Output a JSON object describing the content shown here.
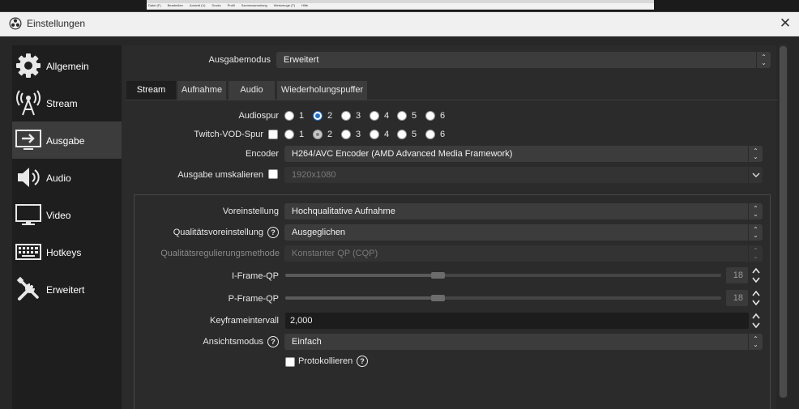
{
  "window": {
    "title": "Einstellungen",
    "close_glyph": "✕"
  },
  "background_menu": {
    "items": [
      "Datei (F)",
      "Bearbeiten",
      "Ansicht (V)",
      "Docks",
      "Profil",
      "Szenensammlung",
      "Werkzeuge (T)",
      "Hilfe"
    ]
  },
  "sidebar": {
    "items": [
      {
        "label": "Allgemein",
        "icon": "gear-icon"
      },
      {
        "label": "Stream",
        "icon": "antenna-icon"
      },
      {
        "label": "Ausgabe",
        "icon": "output-monitor-icon",
        "active": true
      },
      {
        "label": "Audio",
        "icon": "speaker-icon"
      },
      {
        "label": "Video",
        "icon": "monitor-icon"
      },
      {
        "label": "Hotkeys",
        "icon": "keyboard-icon"
      },
      {
        "label": "Erweitert",
        "icon": "tools-icon"
      }
    ]
  },
  "output_mode": {
    "label": "Ausgabemodus",
    "value": "Erweitert"
  },
  "tabs": [
    {
      "label": "Stream",
      "active": true
    },
    {
      "label": "Aufnahme"
    },
    {
      "label": "Audio"
    },
    {
      "label": "Wiederholungspuffer"
    }
  ],
  "audio_track": {
    "label": "Audiospur",
    "options": [
      "1",
      "2",
      "3",
      "4",
      "5",
      "6"
    ],
    "selected": "2"
  },
  "twitch_vod": {
    "label": "Twitch-VOD-Spur",
    "options": [
      "1",
      "2",
      "3",
      "4",
      "5",
      "6"
    ],
    "selected": "2",
    "checked": false
  },
  "encoder": {
    "label": "Encoder",
    "value": "H264/AVC Encoder (AMD Advanced Media Framework)"
  },
  "rescale": {
    "label": "Ausgabe umskalieren",
    "checked": false,
    "value": "1920x1080"
  },
  "preset": {
    "label": "Voreinstellung",
    "value": "Hochqualitative Aufnahme"
  },
  "quality_preset": {
    "label": "Qualitätsvoreinstellung",
    "value": "Ausgeglichen"
  },
  "rate_control": {
    "label": "Qualitätsregulierungsmethode",
    "value": "Konstanter QP (CQP)"
  },
  "iframe_qp": {
    "label": "I-Frame-QP",
    "value": "18",
    "level_fraction": 0.35
  },
  "pframe_qp": {
    "label": "P-Frame-QP",
    "value": "18",
    "level_fraction": 0.35
  },
  "keyframe": {
    "label": "Keyframeintervall",
    "value": "2,000"
  },
  "view_mode": {
    "label": "Ansichtsmodus",
    "value": "Einfach"
  },
  "logging": {
    "label": "Protokollieren",
    "checked": false
  },
  "colors": {
    "accent": "#1f6fd0",
    "background": "#2b2b2b",
    "sidebar": "#1e1e1e"
  }
}
